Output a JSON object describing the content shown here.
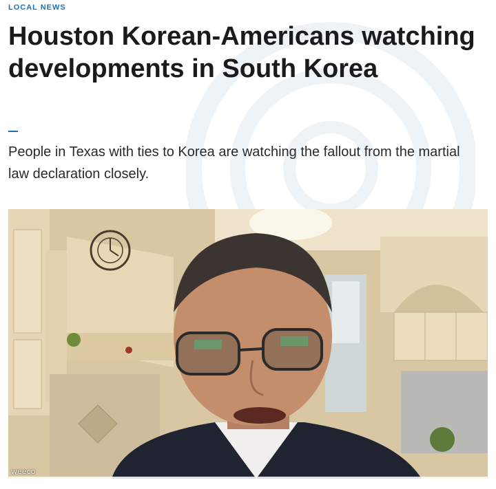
{
  "article": {
    "section_label": "LOCAL NEWS",
    "headline": "Houston Korean-Americans watching developments in South Korea",
    "summary": "People in Texas with ties to Korea are watching the fallout from the martial law declaration closely."
  },
  "video": {
    "watermark": "weeco"
  },
  "colors": {
    "accent": "#1a73b8",
    "text": "#1b1b1b"
  },
  "icons": [
    "background-circle-graphic"
  ]
}
